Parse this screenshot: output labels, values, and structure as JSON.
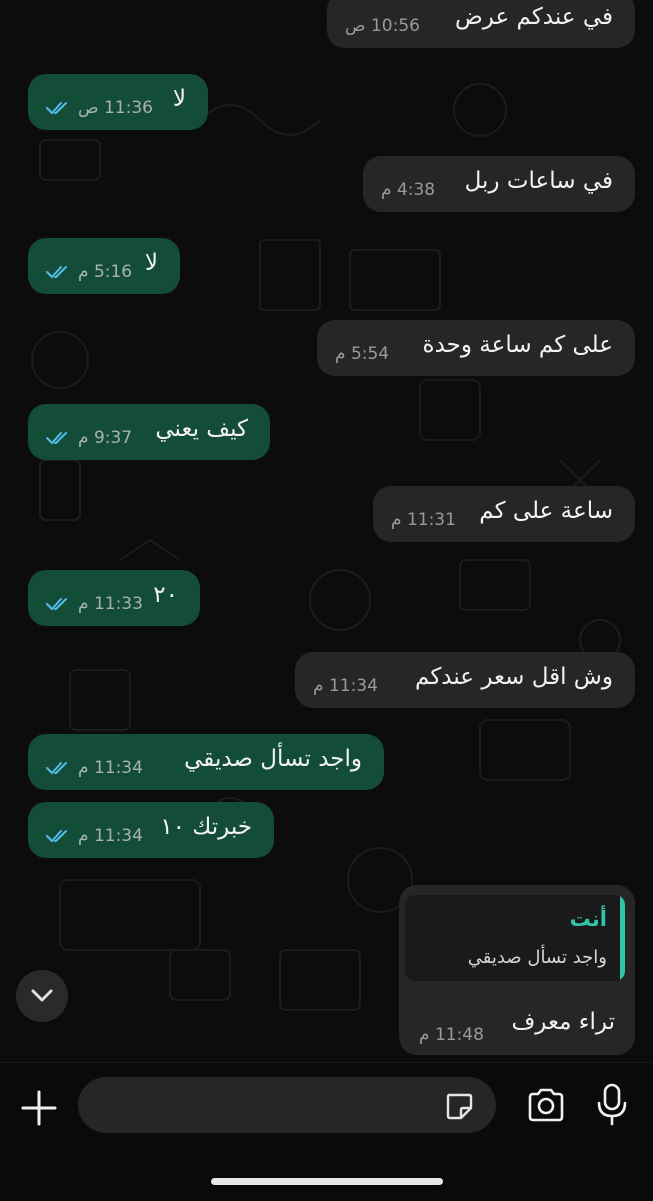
{
  "messages": [
    {
      "dir": "in",
      "text": "في عندكم عرض",
      "time": "10:56 ص"
    },
    {
      "dir": "out",
      "text": "لا",
      "time": "11:36 ص"
    },
    {
      "dir": "in",
      "text": "في ساعات ربل",
      "time": "4:38 م"
    },
    {
      "dir": "out",
      "text": "لا",
      "time": "5:16 م"
    },
    {
      "dir": "in",
      "text": "على كم ساعة وحدة",
      "time": "5:54 م"
    },
    {
      "dir": "out",
      "text": "كيف يعني",
      "time": "9:37 م"
    },
    {
      "dir": "in",
      "text": "ساعة على كم",
      "time": "11:31 م"
    },
    {
      "dir": "out",
      "text": "٢٠",
      "time": "11:33 م"
    },
    {
      "dir": "in",
      "text": "وش اقل سعر عندكم",
      "time": "11:34 م"
    },
    {
      "dir": "out",
      "text": "واجد تسأل صديقي",
      "time": "11:34 م"
    },
    {
      "dir": "out",
      "text": "خبرتك ١٠",
      "time": "11:34 م"
    }
  ],
  "reply": {
    "quote_author": "أنت",
    "quote_text": "واجد تسأل صديقي",
    "text": "تراء معرف",
    "time": "11:48 م"
  },
  "input": {
    "placeholder": ""
  },
  "icons": {
    "plus": "plus-icon",
    "sticker": "sticker-icon",
    "camera": "camera-icon",
    "mic": "microphone-icon",
    "scroll": "chevron-down-icon",
    "read": "double-check-icon"
  },
  "colors": {
    "incoming_bubble": "#262626",
    "outgoing_bubble": "#144d37",
    "read_ticks": "#53bdeb",
    "reply_accent": "#2fc5a8"
  }
}
